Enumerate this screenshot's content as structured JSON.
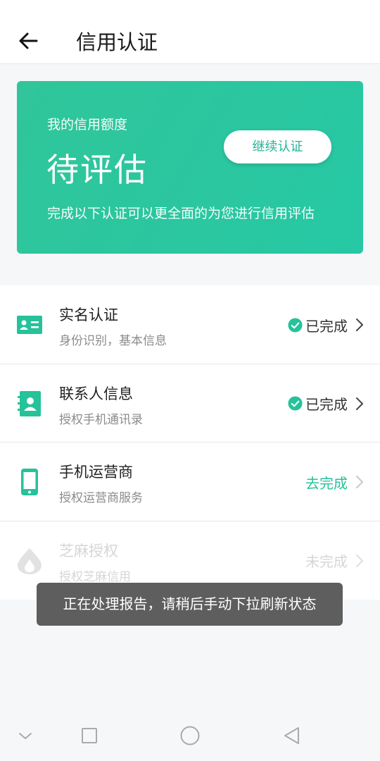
{
  "header": {
    "title": "信用认证",
    "back_icon": "arrow-left-icon"
  },
  "credit_card": {
    "label": "我的信用额度",
    "status": "待评估",
    "description": "完成以下认证可以更全面的为您进行信用评估",
    "continue_button": "继续认证",
    "gradient_colors": [
      "#30c59a",
      "#26c8a5"
    ]
  },
  "auth_items": [
    {
      "title": "实名认证",
      "subtitle": "身份识别，基本信息",
      "status": "已完成",
      "icon": "id-card-icon",
      "state": "done"
    },
    {
      "title": "联系人信息",
      "subtitle": "授权手机通讯录",
      "status": "已完成",
      "icon": "contacts-book-icon",
      "state": "done"
    },
    {
      "title": "手机运营商",
      "subtitle": "授权运营商服务",
      "status": "去完成",
      "icon": "mobile-phone-icon",
      "state": "todo"
    },
    {
      "title": "芝麻授权",
      "subtitle": "授权芝麻信用",
      "status": "未完成",
      "icon": "sesame-drop-icon",
      "state": "disabled"
    }
  ],
  "toast": {
    "message": "正在处理报告，请稍后手动下拉刷新状态"
  },
  "nav_bar": {
    "buttons": [
      "collapse-chevron-icon",
      "recent-apps-square-icon",
      "home-circle-icon",
      "back-triangle-icon"
    ]
  },
  "colors": {
    "accent": "#26c29a",
    "toast_bg": "#505050",
    "disabled": "#d6d6d6"
  }
}
